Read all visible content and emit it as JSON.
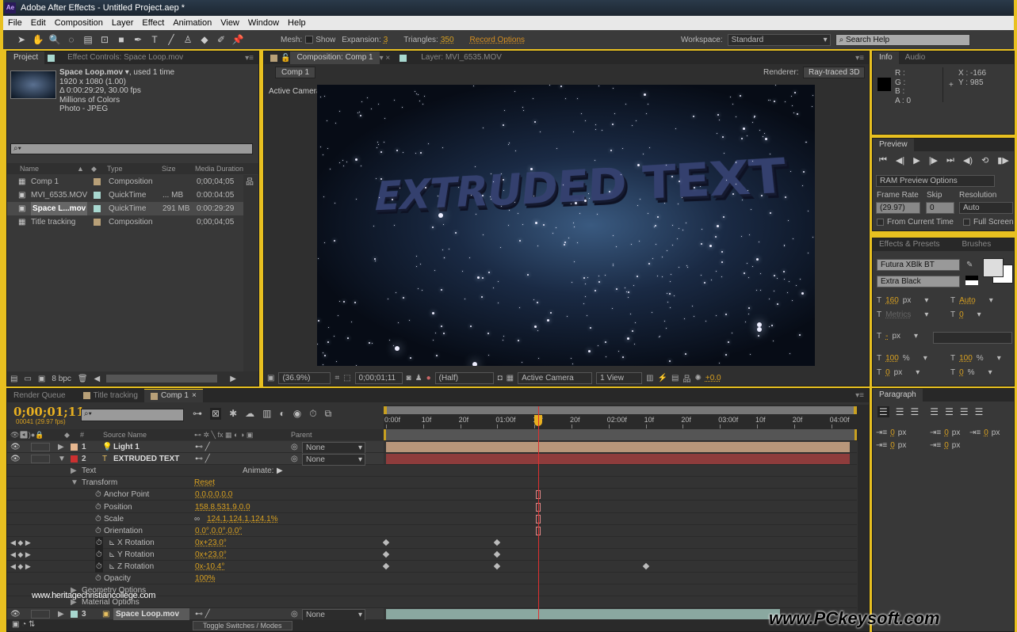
{
  "app": {
    "title": "Adobe After Effects - Untitled Project.aep *",
    "logo": "Ae"
  },
  "menu": [
    "File",
    "Edit",
    "Composition",
    "Layer",
    "Effect",
    "Animation",
    "View",
    "Window",
    "Help"
  ],
  "toolbar": {
    "tools": [
      "selection-icon",
      "hand-icon",
      "zoom-icon",
      "rotate-icon",
      "camera-icon",
      "pan-behind-icon",
      "rectangle-icon",
      "pen-icon",
      "type-icon",
      "brush-icon",
      "clone-stamp-icon",
      "eraser-icon",
      "roto-brush-icon",
      "puppet-pin-icon"
    ],
    "mesh_label": "Mesh:",
    "show_label": "Show",
    "expansion_label": "Expansion:",
    "expansion": "3",
    "triangles_label": "Triangles:",
    "triangles": "350",
    "record_options": "Record Options",
    "workspace_label": "Workspace:",
    "workspace": "Standard",
    "search_placeholder": "Search Help"
  },
  "project": {
    "tabs": [
      "Project",
      "Effect Controls: Space Loop.mov"
    ],
    "item_name": "Space Loop.mov",
    "used": ", used 1 time",
    "info": [
      "1920 x 1080 (1.00)",
      "Δ 0:00:29:29, 30.00 fps",
      "Millions of Colors",
      "Photo - JPEG"
    ],
    "columns": [
      "Name",
      "Type",
      "Size",
      "Media Duration"
    ],
    "items": [
      {
        "name": "Comp 1",
        "type": "Composition",
        "size": "",
        "duration": "0;00;04;05",
        "label": "#b8a078",
        "icon": "composition-icon"
      },
      {
        "name": "MVI_6535.MOV",
        "type": "QuickTime",
        "size": "... MB",
        "duration": "0:00:04:05",
        "label": "#a8d8d0",
        "icon": "footage-icon"
      },
      {
        "name": "Space L...mov",
        "type": "QuickTime",
        "size": "291 MB",
        "duration": "0:00:29:29",
        "label": "#a8d8d0",
        "icon": "footage-icon",
        "selected": true
      },
      {
        "name": "Title tracking",
        "type": "Composition",
        "size": "",
        "duration": "0;00;04;05",
        "label": "#b8a078",
        "icon": "composition-icon"
      }
    ],
    "bpc": "8 bpc"
  },
  "comp": {
    "tabs": [
      "Composition: Comp 1",
      "Layer: MVI_6535.MOV"
    ],
    "breadcrumb": "Comp 1",
    "renderer_label": "Renderer:",
    "renderer": "Ray-traced 3D",
    "view_label": "Active Camera",
    "text": "EXTRUDED TEXT",
    "footer": {
      "zoom": "(36.9%)",
      "timecode": "0;00;01;11",
      "resolution": "(Half)",
      "camera": "Active Camera",
      "views": "1 View",
      "exposure": "+0.0"
    }
  },
  "info": {
    "tabs": [
      "Info",
      "Audio"
    ],
    "r": "R :",
    "g": "G :",
    "b": "B :",
    "a": "A : 0",
    "x": "X : -166",
    "y": "Y : 985"
  },
  "preview": {
    "tab": "Preview",
    "ram": "RAM Preview Options",
    "frame_rate_label": "Frame Rate",
    "skip_label": "Skip",
    "resolution_label": "Resolution",
    "frame_rate": "(29.97)",
    "skip": "0",
    "resolution": "Auto",
    "from_current": "From Current Time",
    "full_screen": "Full Screen"
  },
  "character": {
    "tabs": [
      "Effects & Presets",
      "Brushes"
    ],
    "font": "Futura XBlk BT",
    "style": "Extra Black",
    "size": "160",
    "size_unit": "px",
    "leading": "Auto",
    "kerning": "Metrics",
    "tracking": "0",
    "stroke": "-",
    "stroke_unit": "px",
    "vscale": "100",
    "hscale": "100",
    "pct": "%",
    "baseline": "0",
    "baseline_unit": "px",
    "tsume": "0",
    "tsume_unit": "%"
  },
  "paragraph": {
    "tab": "Paragraph",
    "indents": [
      "0",
      "0",
      "0",
      "0",
      "0"
    ],
    "unit": "px"
  },
  "timeline": {
    "tabs": [
      "Render Queue",
      "Title tracking",
      "Comp 1"
    ],
    "timecode": "0;00;01;11",
    "frames": "00041 (29.97 fps)",
    "columns": {
      "num": "#",
      "source": "Source Name",
      "parent": "Parent"
    },
    "ruler": [
      "0:00f",
      "10f",
      "20f",
      "01:00f",
      "10f",
      "20f",
      "02:00f",
      "10f",
      "20f",
      "03:00f",
      "10f",
      "20f",
      "04:00f"
    ],
    "playhead_time": "0;00;01;11",
    "layers": [
      {
        "kind": "layer",
        "num": "1",
        "name": "Light 1",
        "label": "#e8b890",
        "icon": "light-icon",
        "parent": "None",
        "bar": "#b8967a"
      },
      {
        "kind": "layer",
        "num": "2",
        "name": "EXTRUDED TEXT",
        "label": "#cc3030",
        "icon": "text-layer-icon",
        "parent": "None",
        "bar": "#8e3c3c",
        "open": true
      },
      {
        "kind": "group",
        "indent": 1,
        "name": "Text",
        "value": "",
        "animate": "Animate:"
      },
      {
        "kind": "group",
        "indent": 1,
        "name": "Transform",
        "value": "Reset",
        "open": true
      },
      {
        "kind": "prop",
        "name": "Anchor Point",
        "value": "0.0,0.0,0.0"
      },
      {
        "kind": "prop",
        "name": "Position",
        "value": "158.8,531.9,0.0"
      },
      {
        "kind": "prop",
        "name": "Scale",
        "value": "124.1,124.1,124.1%",
        "link": true
      },
      {
        "kind": "prop",
        "name": "Orientation",
        "value": "0.0°,0.0°,0.0°"
      },
      {
        "kind": "prop",
        "name": "X Rotation",
        "value": "0x+23.0°",
        "keyed": true,
        "keyframes": [
          "0;00;00;00",
          "0;00;01;00"
        ]
      },
      {
        "kind": "prop",
        "name": "Y Rotation",
        "value": "0x+23.0°",
        "keyed": true,
        "keyframes": [
          "0;00;00;00",
          "0;00;01;00"
        ]
      },
      {
        "kind": "prop",
        "name": "Z Rotation",
        "value": "0x-10.4°",
        "keyed": true,
        "keyframes": [
          "0;00;00;00",
          "0;00;01;00",
          "0;00;02;10"
        ]
      },
      {
        "kind": "prop",
        "name": "Opacity",
        "value": "100%"
      },
      {
        "kind": "group",
        "indent": 1,
        "name": "Geometry Options",
        "value": ""
      },
      {
        "kind": "group",
        "indent": 1,
        "name": "Material Options",
        "value": ""
      },
      {
        "kind": "layer",
        "num": "3",
        "name": "Space Loop.mov",
        "label": "#a8d8d0",
        "icon": "footage-icon",
        "parent": "None",
        "bar": "#8aa8a0"
      }
    ],
    "toggle": "Toggle Switches / Modes"
  },
  "watermarks": [
    "www.heritagechristiancollege.com",
    "www.PCkeysoft.com"
  ]
}
